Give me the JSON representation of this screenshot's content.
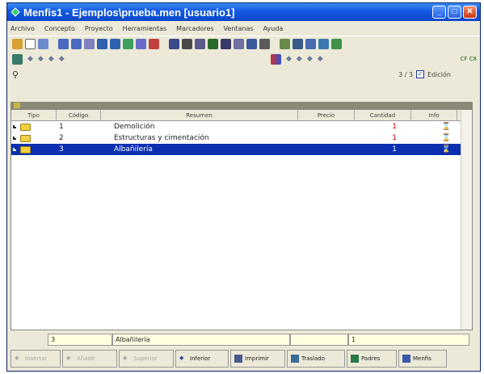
{
  "window": {
    "title": "Menfis1 - Ejemplos\\prueba.men   [usuario1]"
  },
  "menu": [
    "Archivo",
    "Concepto",
    "Proyecto",
    "Herramientas",
    "Marcadores",
    "Ventanas",
    "Ayuda"
  ],
  "nav_right": "CF C8",
  "pager": {
    "text": "3 / 3",
    "edicion_label": "Edición",
    "edicion_checked": true
  },
  "table": {
    "columns": [
      "Tipo",
      "Código",
      "Resumen",
      "Precio",
      "Cantidad",
      "Info"
    ],
    "rows": [
      {
        "codigo": "1",
        "resumen": "Demolición",
        "precio": "",
        "cantidad": "1",
        "selected": false
      },
      {
        "codigo": "2",
        "resumen": "Estructuras y cimentación",
        "precio": "",
        "cantidad": "1",
        "selected": false
      },
      {
        "codigo": "3",
        "resumen": "Albañilería",
        "precio": "",
        "cantidad": "1",
        "selected": true
      }
    ]
  },
  "edit": {
    "codigo": "3",
    "resumen": "Albañilería",
    "precio": "",
    "cantidad": "1"
  },
  "buttons": [
    {
      "label": "Insertar",
      "enabled": false
    },
    {
      "label": "Añadir",
      "enabled": false
    },
    {
      "label": "Superior",
      "enabled": false
    },
    {
      "label": "Inferior",
      "enabled": true
    },
    {
      "label": "Imprimir",
      "enabled": true
    },
    {
      "label": "Traslado",
      "enabled": true
    },
    {
      "label": "Padres",
      "enabled": true
    },
    {
      "label": "Menfis",
      "enabled": true
    }
  ],
  "colors": {
    "title_blue": "#0a47c8",
    "selected_row": "#0b2fb0",
    "quantity_red": "#c00000"
  }
}
